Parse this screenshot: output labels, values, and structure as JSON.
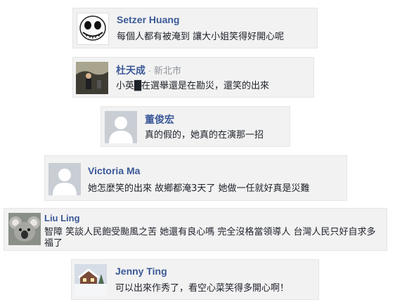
{
  "comments": [
    {
      "name": "Setzer Huang",
      "location": "",
      "text": "每個人都有被淹到 讓大小姐笑得好開心呢",
      "avatar": "skull-face-avatar"
    },
    {
      "name": "杜天成",
      "location": "· 新北市",
      "text": "小英█在選舉還是在勘災，還笑的出來",
      "avatar": "person-photo-avatar"
    },
    {
      "name": "董俊宏",
      "location": "",
      "text": "真的假的，她真的在演那一招",
      "avatar": "default-silhouette-avatar"
    },
    {
      "name": "Victoria Ma",
      "location": "",
      "text": "她怎麼笑的出來 故鄉都淹3天了 她做一任就好真是災難",
      "avatar": "default-silhouette-avatar"
    },
    {
      "name": "Liu Ling",
      "location": "",
      "text": "智障 笑談人民飽受颱風之苦 她還有良心嗎 完全沒格當領導人 台灣人民只好自求多福了",
      "avatar": "koala-avatar"
    },
    {
      "name": "Jenny Ting",
      "location": "",
      "text": "可以出來作秀了，看空心菜笑得多開心啊！",
      "avatar": "snowy-house-avatar"
    }
  ],
  "colors": {
    "name": "#3b5998",
    "card": "#f2f2f2",
    "text": "#1d2129",
    "location": "#90949c"
  }
}
